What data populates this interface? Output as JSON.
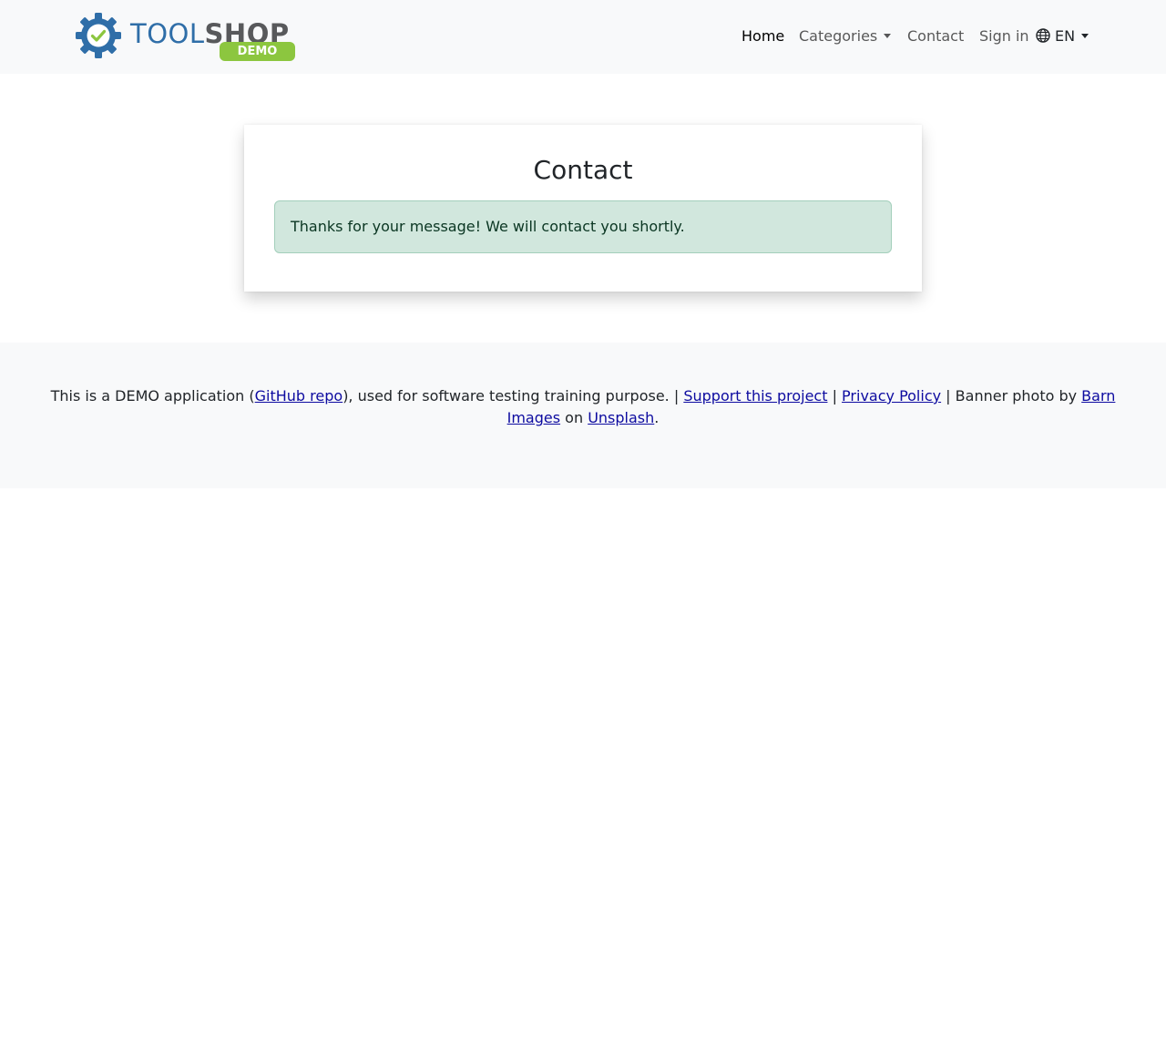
{
  "header": {
    "logo": {
      "text_part1": "TOOL",
      "text_part2": "SHOP",
      "badge": "DEMO",
      "gear_color": "#2f6ea8",
      "check_color": "#8cc63f"
    },
    "nav": {
      "home": "Home",
      "categories": "Categories",
      "contact": "Contact",
      "sign_in": "Sign in",
      "language": "EN"
    }
  },
  "main": {
    "title": "Contact",
    "alert": "Thanks for your message! We will contact you shortly."
  },
  "footer": {
    "t1": "This is a DEMO application (",
    "github_link": "GitHub repo",
    "t2": "), used for software testing training purpose. | ",
    "support_link": "Support this project",
    "t3": " | ",
    "privacy_link": "Privacy Policy",
    "t4": " | Banner photo by ",
    "barn_link": "Barn Images",
    "t5": " on ",
    "unsplash_link": "Unsplash",
    "t6": "."
  },
  "colors": {
    "navbar_bg": "#f8f9fa",
    "alert_bg": "#d1e7dd",
    "alert_text": "#0a3622",
    "link": "#0d0ba0",
    "brand_blue": "#2f6ea8",
    "brand_green": "#8cc63f",
    "brand_gray": "#58595b"
  }
}
